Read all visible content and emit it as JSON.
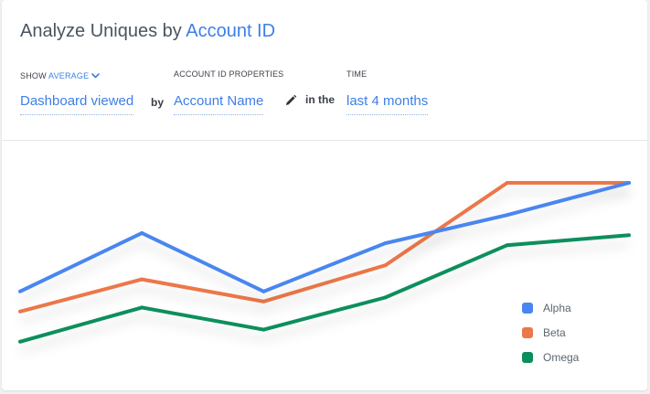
{
  "header": {
    "title_prefix": "Analyze Uniques by",
    "title_accent": "Account ID"
  },
  "controls": {
    "show_label": "SHOW",
    "show_value": "AVERAGE",
    "account_props_label": "ACCOUNT ID PROPERTIES",
    "time_label": "TIME",
    "event": "Dashboard viewed",
    "by": "by",
    "property": "Account Name",
    "in_the": "in the",
    "time_range": "last 4 months"
  },
  "colors": {
    "accent": "#3d7fe6",
    "alpha": "#4a86f0",
    "beta": "#ec7748",
    "omega": "#0a8f5c"
  },
  "icons": {
    "show_dropdown": "chevron-down-icon",
    "edit": "pencil-icon"
  },
  "chart_data": {
    "type": "line",
    "x": [
      1,
      2,
      3,
      4,
      5,
      6
    ],
    "ylim": [
      0,
      100
    ],
    "grid": false,
    "axes_visible": false,
    "legend": "bottom-right",
    "series": [
      {
        "name": "Alpha",
        "color": "#4a86f0",
        "values": [
          46,
          75,
          46,
          70,
          84,
          100
        ]
      },
      {
        "name": "Beta",
        "color": "#ec7748",
        "values": [
          36,
          52,
          41,
          59,
          100,
          100
        ]
      },
      {
        "name": "Omega",
        "color": "#0a8f5c",
        "values": [
          21,
          38,
          27,
          43,
          69,
          74
        ]
      }
    ]
  }
}
